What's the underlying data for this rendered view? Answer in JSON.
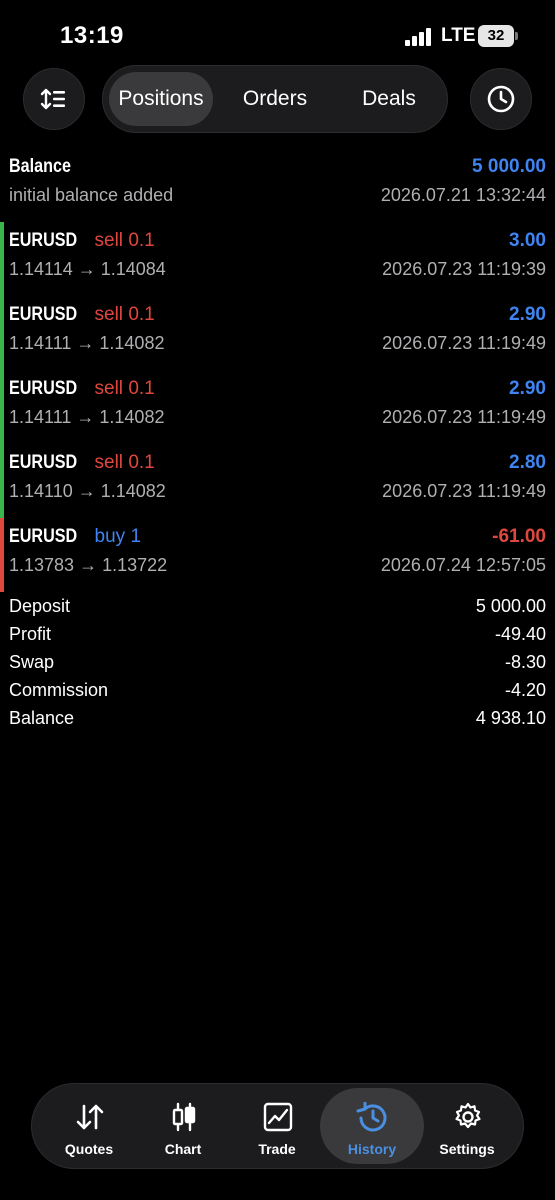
{
  "status": {
    "time": "13:19",
    "network": "LTE",
    "battery": "32"
  },
  "tabs": {
    "positions": "Positions",
    "orders": "Orders",
    "deals": "Deals",
    "active": "Positions"
  },
  "icons": {
    "sort": "sort-icon",
    "history": "clock-icon"
  },
  "colors": {
    "sell": "#e0473e",
    "buy": "#3f84f0",
    "profit_positive": "#3f84f0",
    "profit_negative": "#e0473e",
    "accent": "#4a90e2"
  },
  "balance_entry": {
    "title": "Balance",
    "amount": "5 000.00",
    "comment": "initial balance added",
    "time": "2026.07.21 13:32:44"
  },
  "deals": [
    {
      "symbol": "EURUSD",
      "side": "sell",
      "volume": "0.1",
      "prices": "1.14114 → 1.14084",
      "profit": "3.00",
      "time": "2026.07.23 11:19:39"
    },
    {
      "symbol": "EURUSD",
      "side": "sell",
      "volume": "0.1",
      "prices": "1.14111 → 1.14082",
      "profit": "2.90",
      "time": "2026.07.23 11:19:49"
    },
    {
      "symbol": "EURUSD",
      "side": "sell",
      "volume": "0.1",
      "prices": "1.14111 → 1.14082",
      "profit": "2.90",
      "time": "2026.07.23 11:19:49"
    },
    {
      "symbol": "EURUSD",
      "side": "sell",
      "volume": "0.1",
      "prices": "1.14110 → 1.14082",
      "profit": "2.80",
      "time": "2026.07.23 11:19:49"
    },
    {
      "symbol": "EURUSD",
      "side": "buy",
      "volume": "1",
      "prices": "1.13783 → 1.13722",
      "profit": "-61.00",
      "time": "2026.07.24 12:57:05"
    }
  ],
  "summary": [
    {
      "label": "Deposit",
      "value": "5 000.00"
    },
    {
      "label": "Profit",
      "value": "-49.40"
    },
    {
      "label": "Swap",
      "value": "-8.30"
    },
    {
      "label": "Commission",
      "value": "-4.20"
    },
    {
      "label": "Balance",
      "value": "4 938.10"
    }
  ],
  "nav": [
    {
      "label": "Quotes",
      "icon": "quotes-arrows-icon"
    },
    {
      "label": "Chart",
      "icon": "candlestick-icon"
    },
    {
      "label": "Trade",
      "icon": "trade-chart-icon"
    },
    {
      "label": "History",
      "icon": "history-clock-icon"
    },
    {
      "label": "Settings",
      "icon": "gear-icon"
    }
  ],
  "nav_active": "History"
}
